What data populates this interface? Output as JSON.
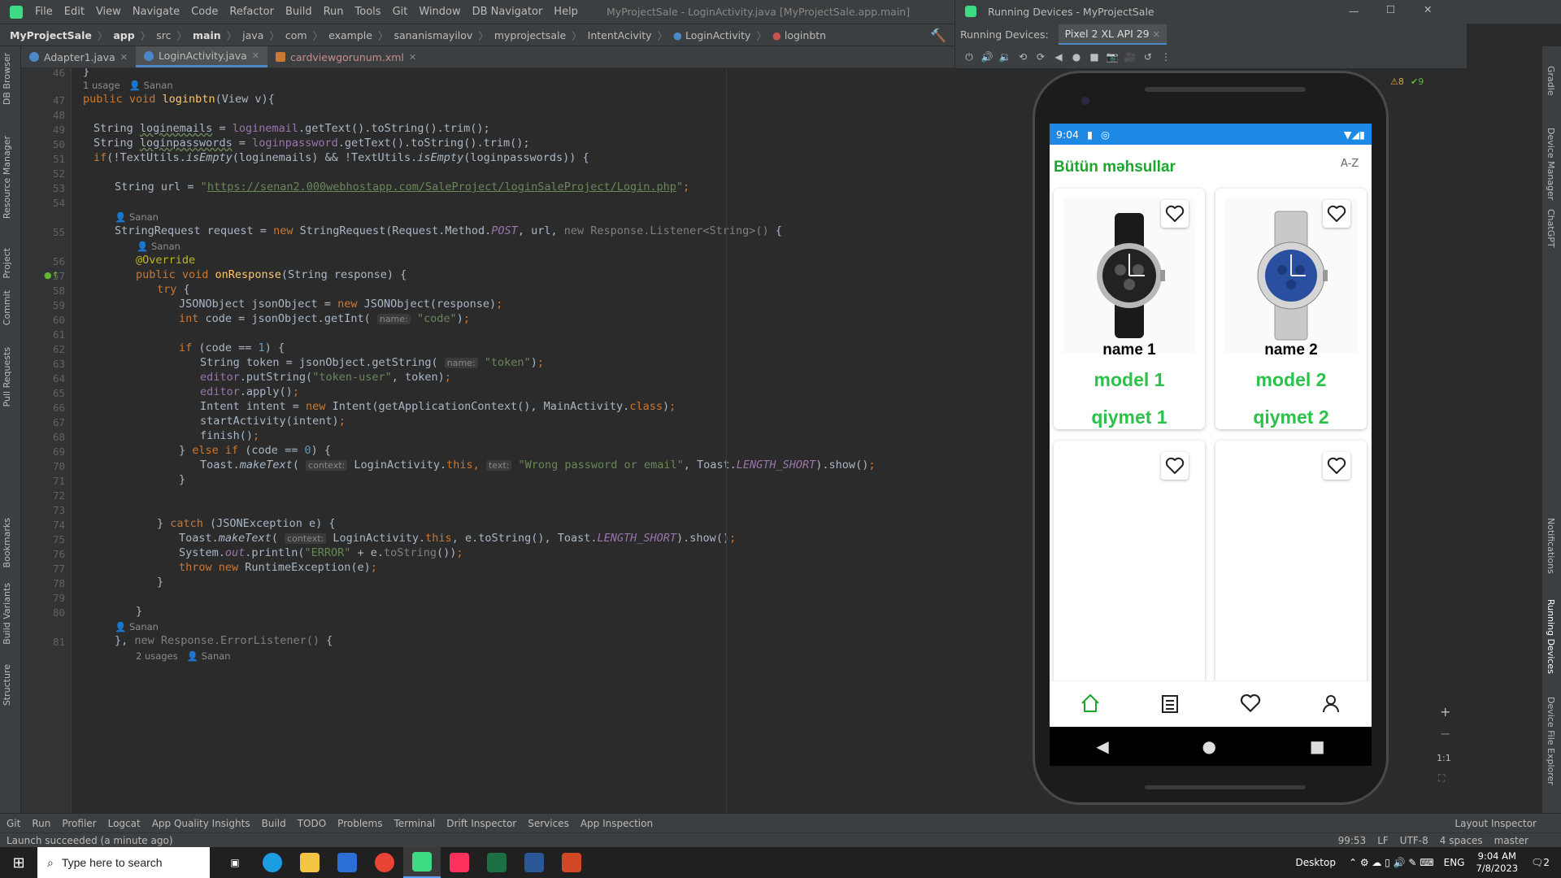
{
  "menubar": {
    "items": [
      "File",
      "Edit",
      "View",
      "Navigate",
      "Code",
      "Refactor",
      "Build",
      "Run",
      "Tools",
      "Git",
      "Window",
      "DB Navigator",
      "Help"
    ],
    "title": "MyProjectSale - LoginActivity.java [MyProjectSale.app.main]"
  },
  "navbar": {
    "crumbs": [
      "MyProjectSale",
      "app",
      "src",
      "main",
      "java",
      "com",
      "example",
      "sananismayilov",
      "myprojectsale",
      "IntentAcivity",
      "LoginActivity",
      "loginbtn"
    ]
  },
  "tabs": [
    {
      "label": "Adapter1.java"
    },
    {
      "label": "LoginActivity.java",
      "active": true
    },
    {
      "label": "cardviewgorunum.xml"
    }
  ],
  "left_strip": [
    "DB Browser",
    "Resource Manager",
    "Project",
    "Commit",
    "Pull Requests",
    "Bookmarks",
    "Build Variants",
    "Structure"
  ],
  "right_strip": [
    "Gradle",
    "Device Manager",
    "ChatGPT",
    "Notifications",
    "Running Devices",
    "Device File Explorer"
  ],
  "editor": {
    "line_numbers": [
      "46",
      "47",
      "48",
      "49",
      "50",
      "51",
      "52",
      "53",
      "54",
      "55",
      "56",
      "57",
      "58",
      "59",
      "60",
      "61",
      "62",
      "63",
      "64",
      "65",
      "66",
      "67",
      "68",
      "69",
      "70",
      "71",
      "72",
      "73",
      "74",
      "75",
      "76",
      "77",
      "78",
      "79",
      "80",
      "81"
    ],
    "hints": {
      "usage": "1 usage",
      "author": "Sanan",
      "usages2": "2 usages"
    },
    "url": "https://senan2.000webhostapp.com/SaleProject/loginSaleProject/Login.php",
    "inspection": {
      "warnings": "8",
      "ok": "9"
    }
  },
  "running_devices": {
    "title": "Running Devices - MyProjectSale",
    "label": "Running Devices:",
    "device_tab": "Pixel 2 XL API 29",
    "zoom_label": "1:1"
  },
  "phone": {
    "time": "9:04",
    "header": "Bütün məhsullar",
    "sort": "A-Z",
    "products": [
      {
        "name": "name 1",
        "model": "model 1",
        "price": "qiymet 1"
      },
      {
        "name": "name 2",
        "model": "model 2",
        "price": "qiymet 2"
      }
    ],
    "nav_icons": [
      "home-icon",
      "orders-icon",
      "favorites-icon",
      "profile-icon"
    ]
  },
  "toolwindows": [
    "Git",
    "Run",
    "Profiler",
    "Logcat",
    "App Quality Insights",
    "Build",
    "TODO",
    "Problems",
    "Terminal",
    "Drift Inspector",
    "Services",
    "App Inspection"
  ],
  "layout_inspector": "Layout Inspector",
  "status": {
    "message": "Launch succeeded (a minute ago)",
    "position": "99:53",
    "line_sep": "LF",
    "encoding": "UTF-8",
    "indent": "4 spaces",
    "branch": "master"
  },
  "taskbar": {
    "search_placeholder": "Type here to search",
    "desktop": "Desktop",
    "lang": "ENG",
    "time": "9:04 AM",
    "date": "7/8/2023",
    "notif_count": "2"
  },
  "colors": {
    "accent": "#1e88e5",
    "green": "#2bc24a",
    "ide_bg": "#2b2b2b"
  }
}
